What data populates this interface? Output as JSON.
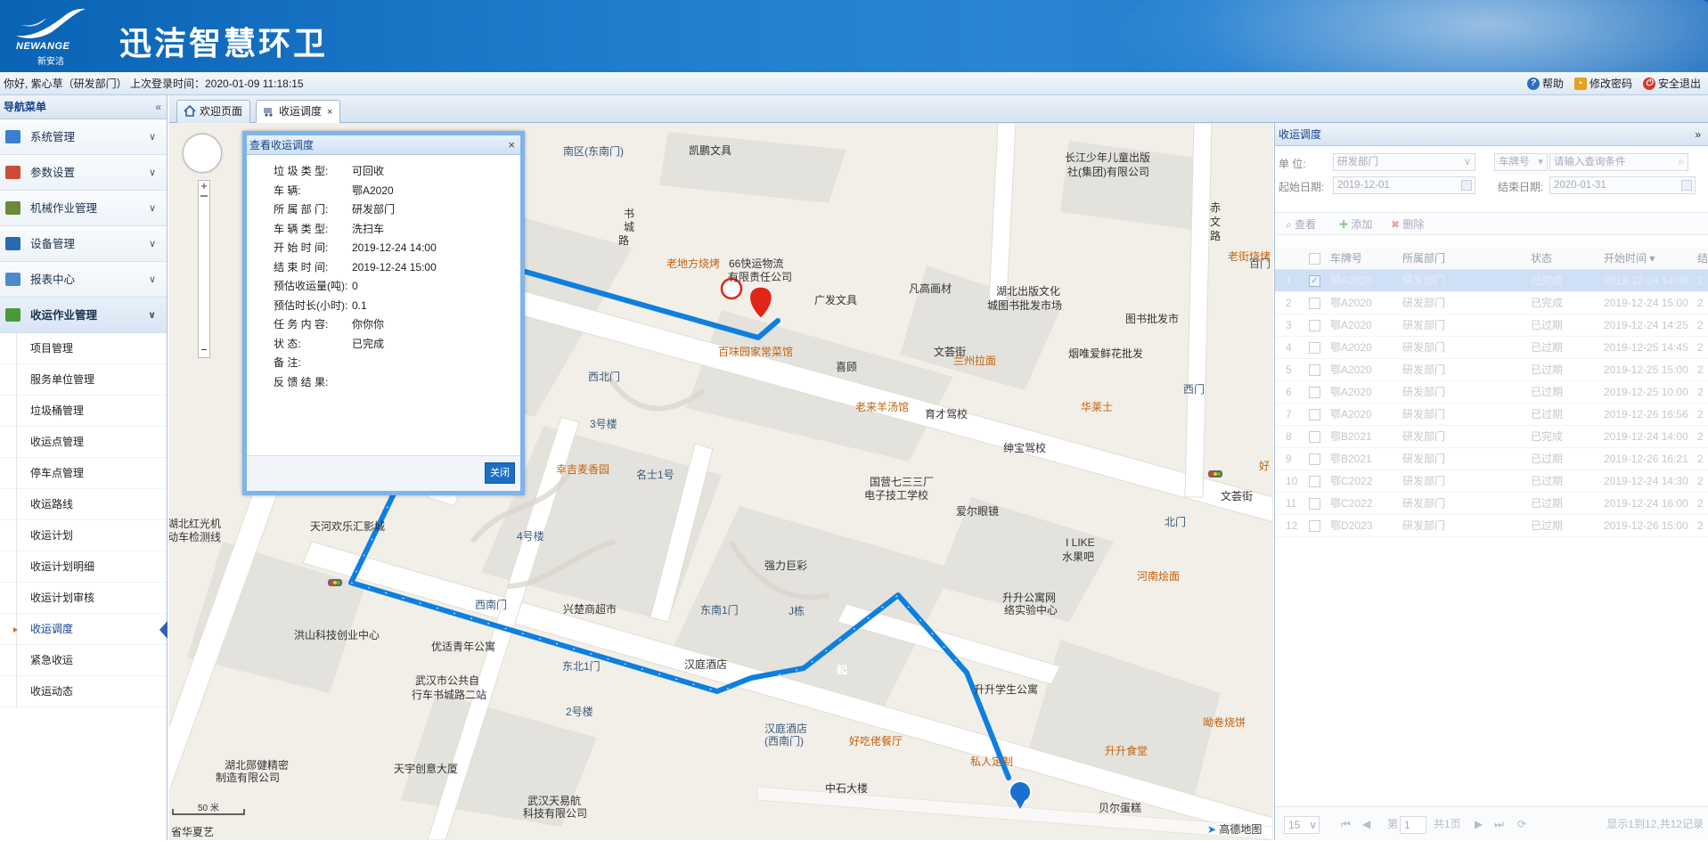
{
  "header": {
    "app_title": "迅洁智慧环卫",
    "logo_brand": "NEWANGE",
    "logo_sub": "新安洁"
  },
  "userbar": {
    "greeting": "你好, 紫心草（研发部门） 上次登录时间：2020-01-09 11:18:15",
    "help": "帮助",
    "change_password": "修改密码",
    "logout": "安全退出"
  },
  "sidebar": {
    "title": "导航菜单",
    "groups": [
      {
        "label": "系统管理",
        "icon_color": "#3a7fd0"
      },
      {
        "label": "参数设置",
        "icon_color": "#d04a3a"
      },
      {
        "label": "机械作业管理",
        "icon_color": "#6a8a3a"
      },
      {
        "label": "设备管理",
        "icon_color": "#2a6ab0"
      },
      {
        "label": "报表中心",
        "icon_color": "#4a8ad0"
      },
      {
        "label": "收运作业管理",
        "icon_color": "#4a9a3a"
      }
    ],
    "sub_items": [
      "项目管理",
      "服务单位管理",
      "垃圾桶管理",
      "收运点管理",
      "停车点管理",
      "收运路线",
      "收运计划",
      "收运计划明细",
      "收运计划审核",
      "收运调度",
      "紧急收运",
      "收运动态"
    ]
  },
  "tabs": [
    {
      "label": "欢迎页面"
    },
    {
      "label": "收运调度",
      "close": "×"
    }
  ],
  "dialog": {
    "title": "查看收运调度",
    "close": "×",
    "fields": [
      {
        "label": "垃 圾 类 型:",
        "value": "可回收"
      },
      {
        "label": "车           辆:",
        "value": "鄂A2020"
      },
      {
        "label": "所 属 部 门:",
        "value": "研发部门"
      },
      {
        "label": "车 辆 类 型:",
        "value": "洗扫车"
      },
      {
        "label": "开 始 时 间:",
        "value": "2019-12-24 14:00"
      },
      {
        "label": "结 束 时 间:",
        "value": "2019-12-24 15:00"
      },
      {
        "label": "预估收运量(吨):",
        "value": "0"
      },
      {
        "label": "预估时长(小时):",
        "value": "0.1"
      },
      {
        "label": "任 务 内 容:",
        "value": "你你你"
      },
      {
        "label": "状           态:",
        "value": "已完成"
      },
      {
        "label": "备           注:",
        "value": ""
      },
      {
        "label": "反 馈 结 果:",
        "value": ""
      }
    ],
    "close_button": "关闭"
  },
  "map": {
    "start_marker": "起",
    "end_marker": "终",
    "scale": "50 米",
    "attribution": "高德地图",
    "pois": [
      {
        "text": "南区(东南门)",
        "style": "blue"
      },
      {
        "text": "凯鹏文具",
        "style": ""
      },
      {
        "text": "长江少年儿童出版",
        "style": ""
      },
      {
        "text": "社(集团)有限公司",
        "style": ""
      },
      {
        "text": "书",
        "style": ""
      },
      {
        "text": "城",
        "style": ""
      },
      {
        "text": "路",
        "style": ""
      },
      {
        "text": "老地方烧烤",
        "style": "orange"
      },
      {
        "text": "66快运物流",
        "style": ""
      },
      {
        "text": "有限责任公司",
        "style": ""
      },
      {
        "text": "广发文具",
        "style": ""
      },
      {
        "text": "凡高画材",
        "style": ""
      },
      {
        "text": "湖北出版文化",
        "style": ""
      },
      {
        "text": "城图书批发市场",
        "style": ""
      },
      {
        "text": "图书批发市",
        "style": ""
      },
      {
        "text": "百味园家常菜馆",
        "style": "orange"
      },
      {
        "text": "喜顾",
        "style": ""
      },
      {
        "text": "文荟街",
        "style": ""
      },
      {
        "text": "兰州拉面",
        "style": "orange"
      },
      {
        "text": "烟唯爱鲜花批发",
        "style": ""
      },
      {
        "text": "西北门",
        "style": "blue"
      },
      {
        "text": "3号楼",
        "style": "blue"
      },
      {
        "text": "老来羊汤馆",
        "style": "orange"
      },
      {
        "text": "育才驾校",
        "style": ""
      },
      {
        "text": "华莱士",
        "style": "orange"
      },
      {
        "text": "名士1号",
        "style": "blue"
      },
      {
        "text": "幸吉麦香园",
        "style": "orange"
      },
      {
        "text": "绅宝驾校",
        "style": ""
      },
      {
        "text": "国营七三三厂",
        "style": ""
      },
      {
        "text": "电子技工学校",
        "style": ""
      },
      {
        "text": "爱尔眼镜",
        "style": ""
      },
      {
        "text": "文荟街",
        "style": ""
      },
      {
        "text": "北门",
        "style": "blue"
      },
      {
        "text": "湖北红光机",
        "style": ""
      },
      {
        "text": "动车检测线",
        "style": ""
      },
      {
        "text": "天河欢乐汇影城",
        "style": ""
      },
      {
        "text": "4号楼",
        "style": "blue"
      },
      {
        "text": "强力巨彩",
        "style": ""
      },
      {
        "text": "I LIKE",
        "style": ""
      },
      {
        "text": "水果吧",
        "style": ""
      },
      {
        "text": "河南烩面",
        "style": "orange"
      },
      {
        "text": "西南门",
        "style": "blue"
      },
      {
        "text": "兴楚商超市",
        "style": ""
      },
      {
        "text": "东南1门",
        "style": "blue"
      },
      {
        "text": "J栋",
        "style": "blue"
      },
      {
        "text": "升升公寓网",
        "style": ""
      },
      {
        "text": "络实验中心",
        "style": ""
      },
      {
        "text": "洪山科技创业中心",
        "style": ""
      },
      {
        "text": "优适青年公寓",
        "style": ""
      },
      {
        "text": "东北1门",
        "style": "blue"
      },
      {
        "text": "汉庭酒店",
        "style": ""
      },
      {
        "text": "升升学生公寓",
        "style": ""
      },
      {
        "text": "武汉市公共自",
        "style": ""
      },
      {
        "text": "行车书城路二站",
        "style": ""
      },
      {
        "text": "2号楼",
        "style": "blue"
      },
      {
        "text": "汉庭酒店",
        "style": "blue"
      },
      {
        "text": "(西南门)",
        "style": "blue"
      },
      {
        "text": "好吃佬餐厅",
        "style": "orange"
      },
      {
        "text": "私人定制",
        "style": "orange"
      },
      {
        "text": "升升食堂",
        "style": "orange"
      },
      {
        "text": "呦卷烧饼",
        "style": "orange"
      },
      {
        "text": "湖北郧健精密",
        "style": ""
      },
      {
        "text": "制造有限公司",
        "style": ""
      },
      {
        "text": "天宇创意大厦",
        "style": ""
      },
      {
        "text": "中石大楼",
        "style": ""
      },
      {
        "text": "武汉天易航",
        "style": ""
      },
      {
        "text": "科技有限公司",
        "style": ""
      },
      {
        "text": "贝尔蛋糕",
        "style": ""
      },
      {
        "text": "省华夏艺",
        "style": ""
      },
      {
        "text": "老街烧烤",
        "style": "orange"
      },
      {
        "text": "赤",
        "style": ""
      },
      {
        "text": "文",
        "style": ""
      },
      {
        "text": "路",
        "style": ""
      },
      {
        "text": "西门",
        "style": "blue"
      },
      {
        "text": "百门",
        "style": "blue"
      },
      {
        "text": "好",
        "style": "orange"
      }
    ]
  },
  "right_panel": {
    "title": "收运调度",
    "filters": {
      "unit_label": "单  位:",
      "unit_value": "研发部门",
      "plate_select": "车牌号",
      "search_placeholder": "请输入查询条件",
      "start_label": "起始日期:",
      "start_value": "2019-12-01",
      "end_label": "结束日期:",
      "end_value": "2020-01-31"
    },
    "toolbar": {
      "view": "查看",
      "add": "添加",
      "delete": "删除"
    },
    "columns": [
      "车牌号",
      "所属部门",
      "状态",
      "开始时间",
      "结"
    ],
    "rows": [
      {
        "n": "1",
        "plate": "鄂A2020",
        "dept": "研发部门",
        "status": "已完成",
        "start": "2019-12-24 14:00",
        "end": "2",
        "selected": true
      },
      {
        "n": "2",
        "plate": "鄂A2020",
        "dept": "研发部门",
        "status": "已完成",
        "start": "2019-12-24 15:00",
        "end": "2"
      },
      {
        "n": "3",
        "plate": "鄂A2020",
        "dept": "研发部门",
        "status": "已过期",
        "start": "2019-12-24 14:25",
        "end": "2"
      },
      {
        "n": "4",
        "plate": "鄂A2020",
        "dept": "研发部门",
        "status": "已过期",
        "start": "2019-12-25 14:45",
        "end": "2"
      },
      {
        "n": "5",
        "plate": "鄂A2020",
        "dept": "研发部门",
        "status": "已过期",
        "start": "2019-12-25 15:00",
        "end": "2"
      },
      {
        "n": "6",
        "plate": "鄂A2020",
        "dept": "研发部门",
        "status": "已过期",
        "start": "2019-12-25 10:00",
        "end": "2"
      },
      {
        "n": "7",
        "plate": "鄂A2020",
        "dept": "研发部门",
        "status": "已过期",
        "start": "2019-12-26 16:56",
        "end": "2"
      },
      {
        "n": "8",
        "plate": "鄂B2021",
        "dept": "研发部门",
        "status": "已完成",
        "start": "2019-12-24 14:00",
        "end": "2"
      },
      {
        "n": "9",
        "plate": "鄂B2021",
        "dept": "研发部门",
        "status": "已过期",
        "start": "2019-12-26 16:21",
        "end": "2"
      },
      {
        "n": "10",
        "plate": "鄂C2022",
        "dept": "研发部门",
        "status": "已过期",
        "start": "2019-12-24 14:30",
        "end": "2"
      },
      {
        "n": "11",
        "plate": "鄂C2022",
        "dept": "研发部门",
        "status": "已过期",
        "start": "2019-12-24 16:00",
        "end": "2"
      },
      {
        "n": "12",
        "plate": "鄂D2023",
        "dept": "研发部门",
        "status": "已过期",
        "start": "2019-12-26 15:00",
        "end": "2"
      }
    ],
    "pager": {
      "page_size": "15",
      "page_label": "第",
      "page_value": "1",
      "total_pages": "共1页",
      "summary": "显示1到12,共12记录"
    }
  }
}
